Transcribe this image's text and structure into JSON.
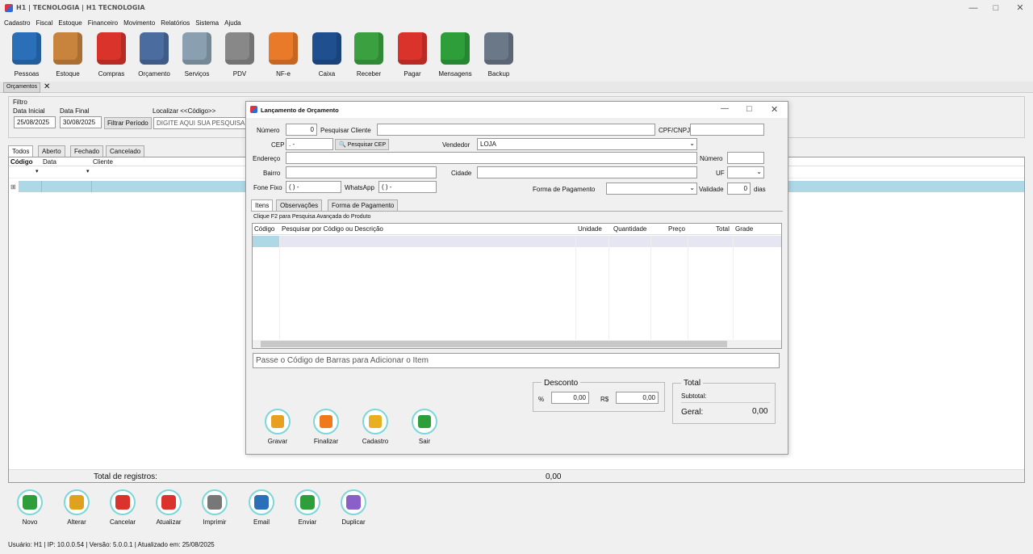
{
  "window": {
    "title": "H1 | TECNOLOGIA | H1 TECNOLOGIA"
  },
  "menu": [
    "Cadastro",
    "Fiscal",
    "Estoque",
    "Financeiro",
    "Movimento",
    "Relatórios",
    "Sistema",
    "Ajuda"
  ],
  "toolbar": [
    {
      "label": "Pessoas",
      "icon": "person-icon"
    },
    {
      "label": "Estoque",
      "icon": "boxes-icon"
    },
    {
      "label": "Compras",
      "icon": "basket-icon"
    },
    {
      "label": "Orçamento",
      "icon": "calculator-icon"
    },
    {
      "label": "Serviços",
      "icon": "tools-icon"
    },
    {
      "label": "PDV",
      "icon": "cash-register-icon"
    },
    {
      "label": "NF-e",
      "icon": "invoice-icon"
    },
    {
      "label": "Caixa",
      "icon": "cash-book-icon"
    },
    {
      "label": "Receber",
      "icon": "receive-money-icon"
    },
    {
      "label": "Pagar",
      "icon": "pay-money-icon"
    },
    {
      "label": "Mensagens",
      "icon": "whatsapp-icon"
    },
    {
      "label": "Backup",
      "icon": "backup-icon"
    }
  ],
  "doc_tab": {
    "label": "Orçamentos"
  },
  "filter": {
    "group_label": "Filtro",
    "start_label": "Data Inicial",
    "start_value": "25/08/2025",
    "end_label": "Data Final",
    "end_value": "30/08/2025",
    "filter_button": "Filtrar Período",
    "search_label": "Localizar <<Código>>",
    "search_value": "DIGITE AQUI SUA PESQUISA"
  },
  "status_tabs": [
    "Todos",
    "Aberto",
    "Fechado",
    "Cancelado"
  ],
  "grid": {
    "columns": [
      "Código",
      "Data",
      "Cliente"
    ],
    "total_label": "Total de registros:",
    "total_value": "0,00"
  },
  "bottom_toolbar": [
    {
      "label": "Novo",
      "icon": "add-icon",
      "color": "#2e9e3a"
    },
    {
      "label": "Alterar",
      "icon": "edit-icon",
      "color": "#e0a020"
    },
    {
      "label": "Cancelar",
      "icon": "cancel-icon",
      "color": "#d9332b"
    },
    {
      "label": "Atualizar",
      "icon": "refresh-icon",
      "color": "#d9332b"
    },
    {
      "label": "Imprimir",
      "icon": "printer-icon",
      "color": "#777777"
    },
    {
      "label": "Email",
      "icon": "email-icon",
      "color": "#2a6fb8"
    },
    {
      "label": "Enviar",
      "icon": "whatsapp-icon",
      "color": "#2e9e3a"
    },
    {
      "label": "Duplicar",
      "icon": "duplicate-icon",
      "color": "#8a5fc8"
    }
  ],
  "statusbar": {
    "text": "Usuário: H1 | IP: 10.0.0.54 | Versão: 5.0.0.1 | Atualizado em: 25/08/2025"
  },
  "dialog": {
    "title": "Lançamento de Orçamento",
    "numero_label": "Número",
    "numero_value": "0",
    "pesquisar_cliente_label": "Pesquisar Cliente",
    "cpf_label": "CPF/CNPJ",
    "cep_label": "CEP",
    "cep_value": "  .   -",
    "pesquisar_cep": "Pesquisar CEP",
    "vendedor_label": "Vendedor",
    "vendedor_value": "LOJA",
    "endereco_label": "Endereço",
    "numero2_label": "Número",
    "bairro_label": "Bairro",
    "cidade_label": "Cidade",
    "uf_label": "UF",
    "fone_label": "Fone Fixo",
    "fone_value": "(  )      -",
    "whats_label": "WhatsApp",
    "whats_value": "(  )       -",
    "forma_label": "Forma de Pagamento",
    "validade_label": "Validade",
    "validade_value": "0",
    "dias_label": "dias",
    "tabs": [
      "Itens",
      "Observações",
      "Forma de Pagamento"
    ],
    "hint": "Clique F2 para Pesquisa Avançada do Produto",
    "item_columns": [
      "Código",
      "Pesquisar por Código ou Descrição",
      "Unidade",
      "Quantidade",
      "Preço",
      "Total",
      "Grade"
    ],
    "barcode_placeholder": "Passe o Código de Barras para Adicionar o Item",
    "desconto_label": "Desconto",
    "pct_label": "%",
    "pct_value": "0,00",
    "rs_label": "R$",
    "rs_value": "0,00",
    "total_label": "Total",
    "subtotal_label": "Subtotal:",
    "geral_label": "Geral:",
    "geral_value": "0,00",
    "buttons": [
      {
        "label": "Gravar",
        "icon": "save-icon",
        "color": "#e8a020"
      },
      {
        "label": "Finalizar",
        "icon": "finalize-icon",
        "color": "#f07a1a"
      },
      {
        "label": "Cadastro",
        "icon": "folder-icon",
        "color": "#e8b020"
      },
      {
        "label": "Sair",
        "icon": "exit-icon",
        "color": "#2e9e3a"
      }
    ]
  }
}
